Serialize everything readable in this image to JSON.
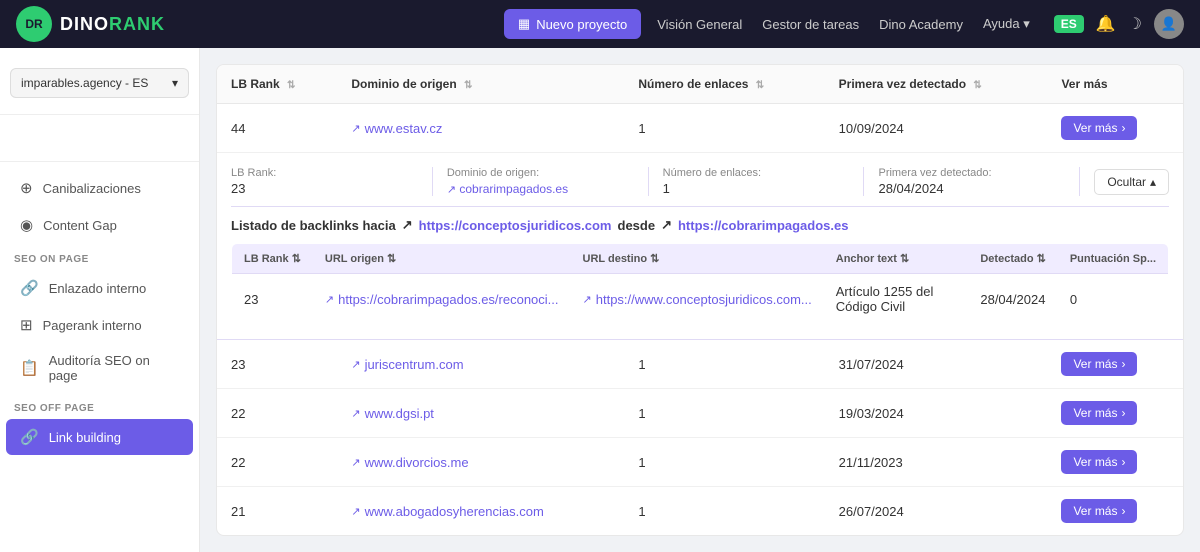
{
  "app": {
    "logo_text": "DINO",
    "logo_highlight": "RANK",
    "nuevo_proyecto": "Nuevo proyecto",
    "nav_links": [
      {
        "label": "Visión General"
      },
      {
        "label": "Gestor de tareas"
      },
      {
        "label": "Dino Academy"
      },
      {
        "label": "Ayuda",
        "has_dropdown": true
      }
    ],
    "lang": "ES",
    "dark_mode_icon": "☽",
    "notification_icon": "🔔"
  },
  "sidebar": {
    "selector_label": "imparables.agency - ES",
    "sections": [
      {
        "label": "",
        "items": []
      },
      {
        "label": "",
        "items": [
          {
            "icon": "⊕",
            "label": "Canibalizaciones",
            "active": false
          },
          {
            "icon": "◉",
            "label": "Content Gap",
            "active": false
          }
        ]
      },
      {
        "label": "SEO ON PAGE",
        "items": [
          {
            "icon": "🔗",
            "label": "Enlazado interno",
            "active": false
          },
          {
            "icon": "⊞",
            "label": "Pagerank interno",
            "active": false
          },
          {
            "icon": "📋",
            "label": "Auditoría SEO on page",
            "active": false
          }
        ]
      },
      {
        "label": "SEO OFF PAGE",
        "items": [
          {
            "icon": "🔗",
            "label": "Link building",
            "active": true
          }
        ]
      }
    ]
  },
  "main_table": {
    "columns": [
      "LB Rank",
      "Dominio de origen",
      "Número de enlaces",
      "Primera vez detectado",
      "Ver más"
    ],
    "rows": [
      {
        "lb_rank": "44",
        "dominio": "www.estav.cz",
        "enlaces": "1",
        "primera_vez": "10/09/2024",
        "ver_mas": "Ver más",
        "expanded": false
      },
      {
        "lb_rank": "23",
        "dominio": "cobrarimpagados.es",
        "enlaces": "1",
        "primera_vez": "28/04/2024",
        "ver_mas": "Ocultar",
        "expanded": true,
        "expanded_data": {
          "meta": {
            "lb_rank_label": "LB Rank:",
            "lb_rank_value": "23",
            "dominio_label": "Dominio de origen:",
            "dominio_value": "cobrarimpagados.es",
            "enlaces_label": "Número de enlaces:",
            "enlaces_value": "1",
            "primera_label": "Primera vez detectado:",
            "primera_value": "28/04/2024"
          },
          "title_prefix": "Listado de backlinks hacia",
          "destination_domain": "https://conceptosjuridicos.com",
          "from_text": "desde",
          "source_domain": "https://cobrarimpagados.es",
          "inner_columns": [
            "LB Rank",
            "URL origen",
            "URL destino",
            "Anchor text",
            "Detectado",
            "Puntuación Sp..."
          ],
          "inner_rows": [
            {
              "lb_rank": "23",
              "url_origen": "https://cobrarimpagados.es/reconoci...",
              "url_destino": "https://www.conceptosjuridicos.com...",
              "anchor_text": "Artículo 1255 del Código Civil",
              "detectado": "28/04/2024",
              "puntuacion": "0"
            }
          ]
        }
      },
      {
        "lb_rank": "23",
        "dominio": "juriscentrum.com",
        "enlaces": "1",
        "primera_vez": "31/07/2024",
        "ver_mas": "Ver más",
        "expanded": false
      },
      {
        "lb_rank": "22",
        "dominio": "www.dgsi.pt",
        "enlaces": "1",
        "primera_vez": "19/03/2024",
        "ver_mas": "Ver más",
        "expanded": false
      },
      {
        "lb_rank": "22",
        "dominio": "www.divorcios.me",
        "enlaces": "1",
        "primera_vez": "21/11/2023",
        "ver_mas": "Ver más",
        "expanded": false
      },
      {
        "lb_rank": "21",
        "dominio": "www.abogadosyherencias.com",
        "enlaces": "1",
        "primera_vez": "26/07/2024",
        "ver_mas": "Ver más",
        "expanded": false
      }
    ]
  }
}
